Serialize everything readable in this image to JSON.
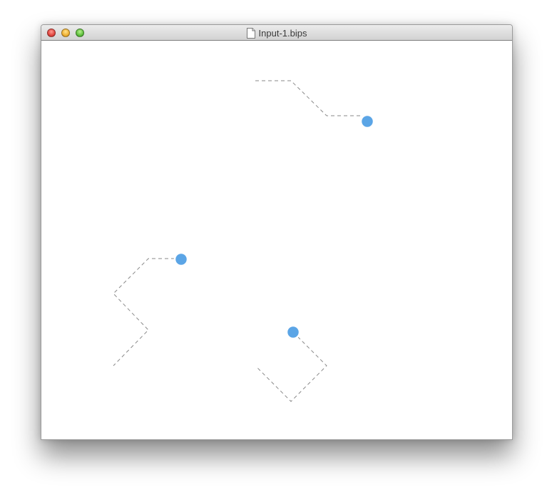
{
  "window": {
    "title": "Input-1.bips",
    "icon": "document-icon"
  },
  "controls": [
    "close-button",
    "minimize-button",
    "zoom-button"
  ],
  "colors": {
    "node_fill": "#5ba5e6",
    "node_stroke": "#ffffff",
    "path_stroke": "#8a8a8a"
  }
}
